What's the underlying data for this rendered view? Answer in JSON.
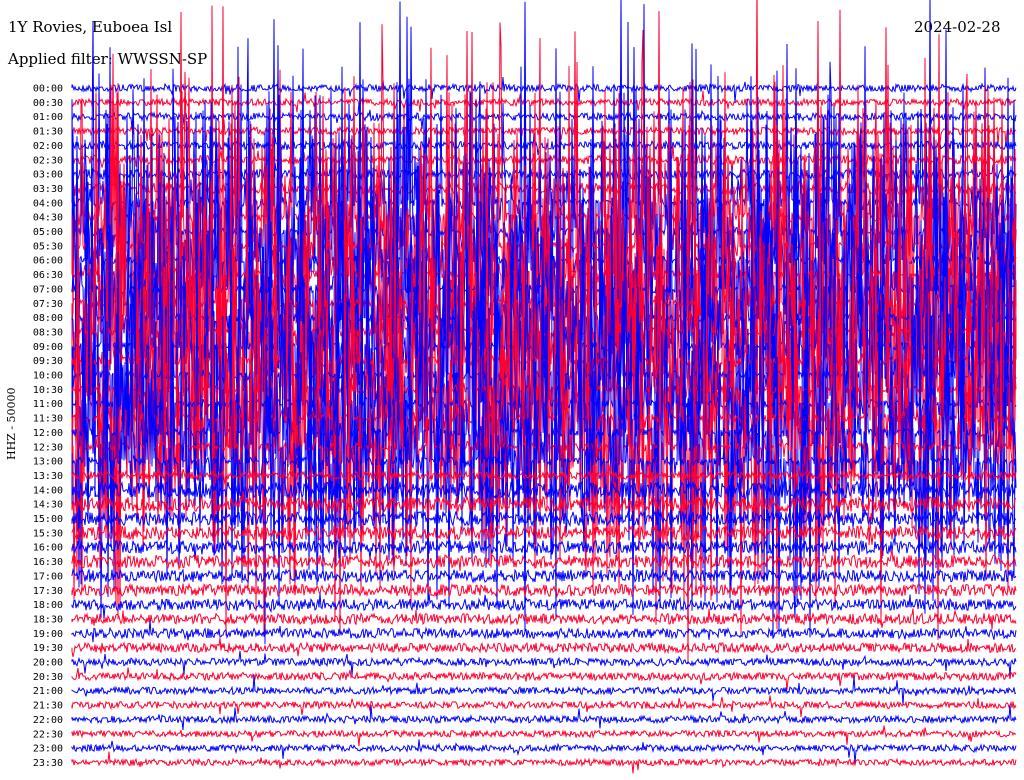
{
  "header": {
    "title": "1Y Rovies, Euboea Isl",
    "filter": "Applied filter: WWSSN-SP",
    "date": "2024-02-28"
  },
  "chart_data": {
    "type": "line",
    "title": "1Y Rovies, Euboea Isl",
    "subtitle": "Applied filter: WWSSN-SP",
    "date": "2024-02-28",
    "ylabel": "HHZ - 50000",
    "xlabel": "",
    "y_tick_labels": [
      "00:00",
      "00:30",
      "01:00",
      "01:30",
      "02:00",
      "02:30",
      "03:00",
      "03:30",
      "04:00",
      "04:30",
      "05:00",
      "05:30",
      "06:00",
      "06:30",
      "07:00",
      "07:30",
      "08:00",
      "08:30",
      "09:00",
      "09:30",
      "10:00",
      "10:30",
      "11:00",
      "11:30",
      "12:00",
      "12:30",
      "13:00",
      "13:30",
      "14:00",
      "14:30",
      "15:00",
      "15:30",
      "16:00",
      "16:30",
      "17:00",
      "17:30",
      "18:00",
      "18:30",
      "19:00",
      "19:30",
      "20:00",
      "20:30",
      "21:00",
      "21:30",
      "22:00",
      "22:30",
      "23:00",
      "23:30"
    ],
    "trace_colors": [
      "#0000ff",
      "#ff0030"
    ],
    "relative_activity": [
      0.05,
      0.05,
      0.06,
      0.06,
      0.07,
      0.08,
      0.1,
      0.12,
      0.95,
      0.95,
      0.95,
      0.95,
      0.95,
      0.95,
      0.95,
      0.95,
      0.95,
      0.95,
      0.95,
      0.95,
      0.95,
      0.95,
      0.95,
      0.95,
      0.95,
      0.9,
      0.75,
      0.45,
      0.2,
      0.18,
      0.17,
      0.16,
      0.15,
      0.15,
      0.14,
      0.13,
      0.12,
      0.11,
      0.1,
      0.09,
      0.06,
      0.06,
      0.05,
      0.05,
      0.05,
      0.04,
      0.04,
      0.04
    ],
    "grid": false,
    "legend": "none"
  }
}
